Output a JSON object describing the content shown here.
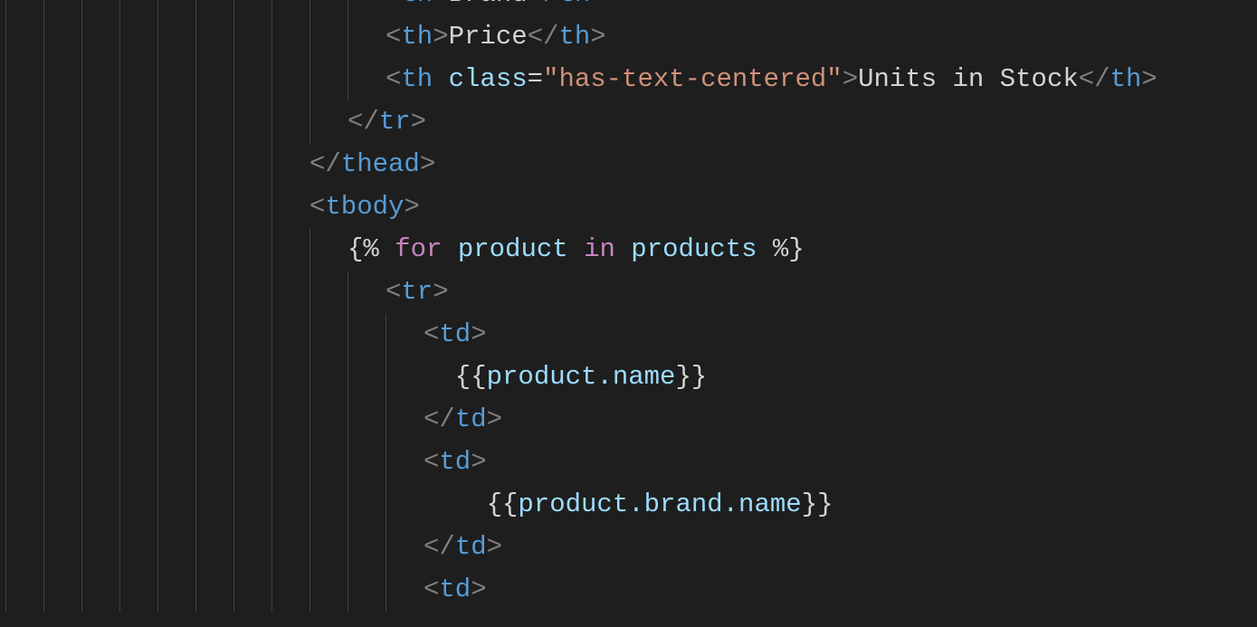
{
  "lines": [
    {
      "indent": 10,
      "segments": [
        {
          "text": "<",
          "cls": "bracket"
        },
        {
          "text": "th",
          "cls": "tag"
        },
        {
          "text": ">",
          "cls": "bracket"
        },
        {
          "text": "Brand",
          "cls": "text"
        },
        {
          "text": "</",
          "cls": "bracket"
        },
        {
          "text": "th",
          "cls": "tag"
        },
        {
          "text": ">",
          "cls": "bracket"
        }
      ]
    },
    {
      "indent": 10,
      "segments": [
        {
          "text": "<",
          "cls": "bracket"
        },
        {
          "text": "th",
          "cls": "tag"
        },
        {
          "text": ">",
          "cls": "bracket"
        },
        {
          "text": "Price",
          "cls": "text"
        },
        {
          "text": "</",
          "cls": "bracket"
        },
        {
          "text": "th",
          "cls": "tag"
        },
        {
          "text": ">",
          "cls": "bracket"
        }
      ]
    },
    {
      "indent": 10,
      "segments": [
        {
          "text": "<",
          "cls": "bracket"
        },
        {
          "text": "th",
          "cls": "tag"
        },
        {
          "text": " ",
          "cls": "text"
        },
        {
          "text": "class",
          "cls": "attr-name"
        },
        {
          "text": "=",
          "cls": "text"
        },
        {
          "text": "\"has-text-centered\"",
          "cls": "attr-value"
        },
        {
          "text": ">",
          "cls": "bracket"
        },
        {
          "text": "Units in Stock",
          "cls": "text"
        },
        {
          "text": "</",
          "cls": "bracket"
        },
        {
          "text": "th",
          "cls": "tag"
        },
        {
          "text": ">",
          "cls": "bracket"
        }
      ]
    },
    {
      "indent": 9,
      "segments": [
        {
          "text": "</",
          "cls": "bracket"
        },
        {
          "text": "tr",
          "cls": "tag"
        },
        {
          "text": ">",
          "cls": "bracket"
        }
      ]
    },
    {
      "indent": 8,
      "segments": [
        {
          "text": "</",
          "cls": "bracket"
        },
        {
          "text": "thead",
          "cls": "tag"
        },
        {
          "text": ">",
          "cls": "bracket"
        }
      ]
    },
    {
      "indent": 8,
      "segments": [
        {
          "text": "<",
          "cls": "bracket"
        },
        {
          "text": "tbody",
          "cls": "tag"
        },
        {
          "text": ">",
          "cls": "bracket"
        }
      ]
    },
    {
      "indent": 9,
      "segments": [
        {
          "text": "{% ",
          "cls": "jinja-delim"
        },
        {
          "text": "for",
          "cls": "keyword"
        },
        {
          "text": " ",
          "cls": "text"
        },
        {
          "text": "product",
          "cls": "variable"
        },
        {
          "text": " ",
          "cls": "text"
        },
        {
          "text": "in",
          "cls": "keyword"
        },
        {
          "text": " ",
          "cls": "text"
        },
        {
          "text": "products",
          "cls": "variable"
        },
        {
          "text": " %}",
          "cls": "jinja-delim"
        }
      ]
    },
    {
      "indent": 10,
      "segments": [
        {
          "text": "<",
          "cls": "bracket"
        },
        {
          "text": "tr",
          "cls": "tag"
        },
        {
          "text": ">",
          "cls": "bracket"
        }
      ]
    },
    {
      "indent": 11,
      "segments": [
        {
          "text": "<",
          "cls": "bracket"
        },
        {
          "text": "td",
          "cls": "tag"
        },
        {
          "text": ">",
          "cls": "bracket"
        }
      ]
    },
    {
      "indent": 11,
      "segments": [
        {
          "text": "  {{",
          "cls": "delim"
        },
        {
          "text": "product.name",
          "cls": "variable"
        },
        {
          "text": "}}",
          "cls": "delim"
        }
      ]
    },
    {
      "indent": 11,
      "segments": [
        {
          "text": "</",
          "cls": "bracket"
        },
        {
          "text": "td",
          "cls": "tag"
        },
        {
          "text": ">",
          "cls": "bracket"
        }
      ]
    },
    {
      "indent": 11,
      "segments": [
        {
          "text": "<",
          "cls": "bracket"
        },
        {
          "text": "td",
          "cls": "tag"
        },
        {
          "text": ">",
          "cls": "bracket"
        }
      ]
    },
    {
      "indent": 11,
      "segments": [
        {
          "text": "    {{",
          "cls": "delim"
        },
        {
          "text": "product.brand.name",
          "cls": "variable"
        },
        {
          "text": "}}",
          "cls": "delim"
        }
      ]
    },
    {
      "indent": 11,
      "segments": [
        {
          "text": "</",
          "cls": "bracket"
        },
        {
          "text": "td",
          "cls": "tag"
        },
        {
          "text": ">",
          "cls": "bracket"
        }
      ]
    },
    {
      "indent": 11,
      "segments": [
        {
          "text": "<",
          "cls": "bracket"
        },
        {
          "text": "td",
          "cls": "tag"
        },
        {
          "text": ">",
          "cls": "bracket"
        }
      ]
    }
  ]
}
